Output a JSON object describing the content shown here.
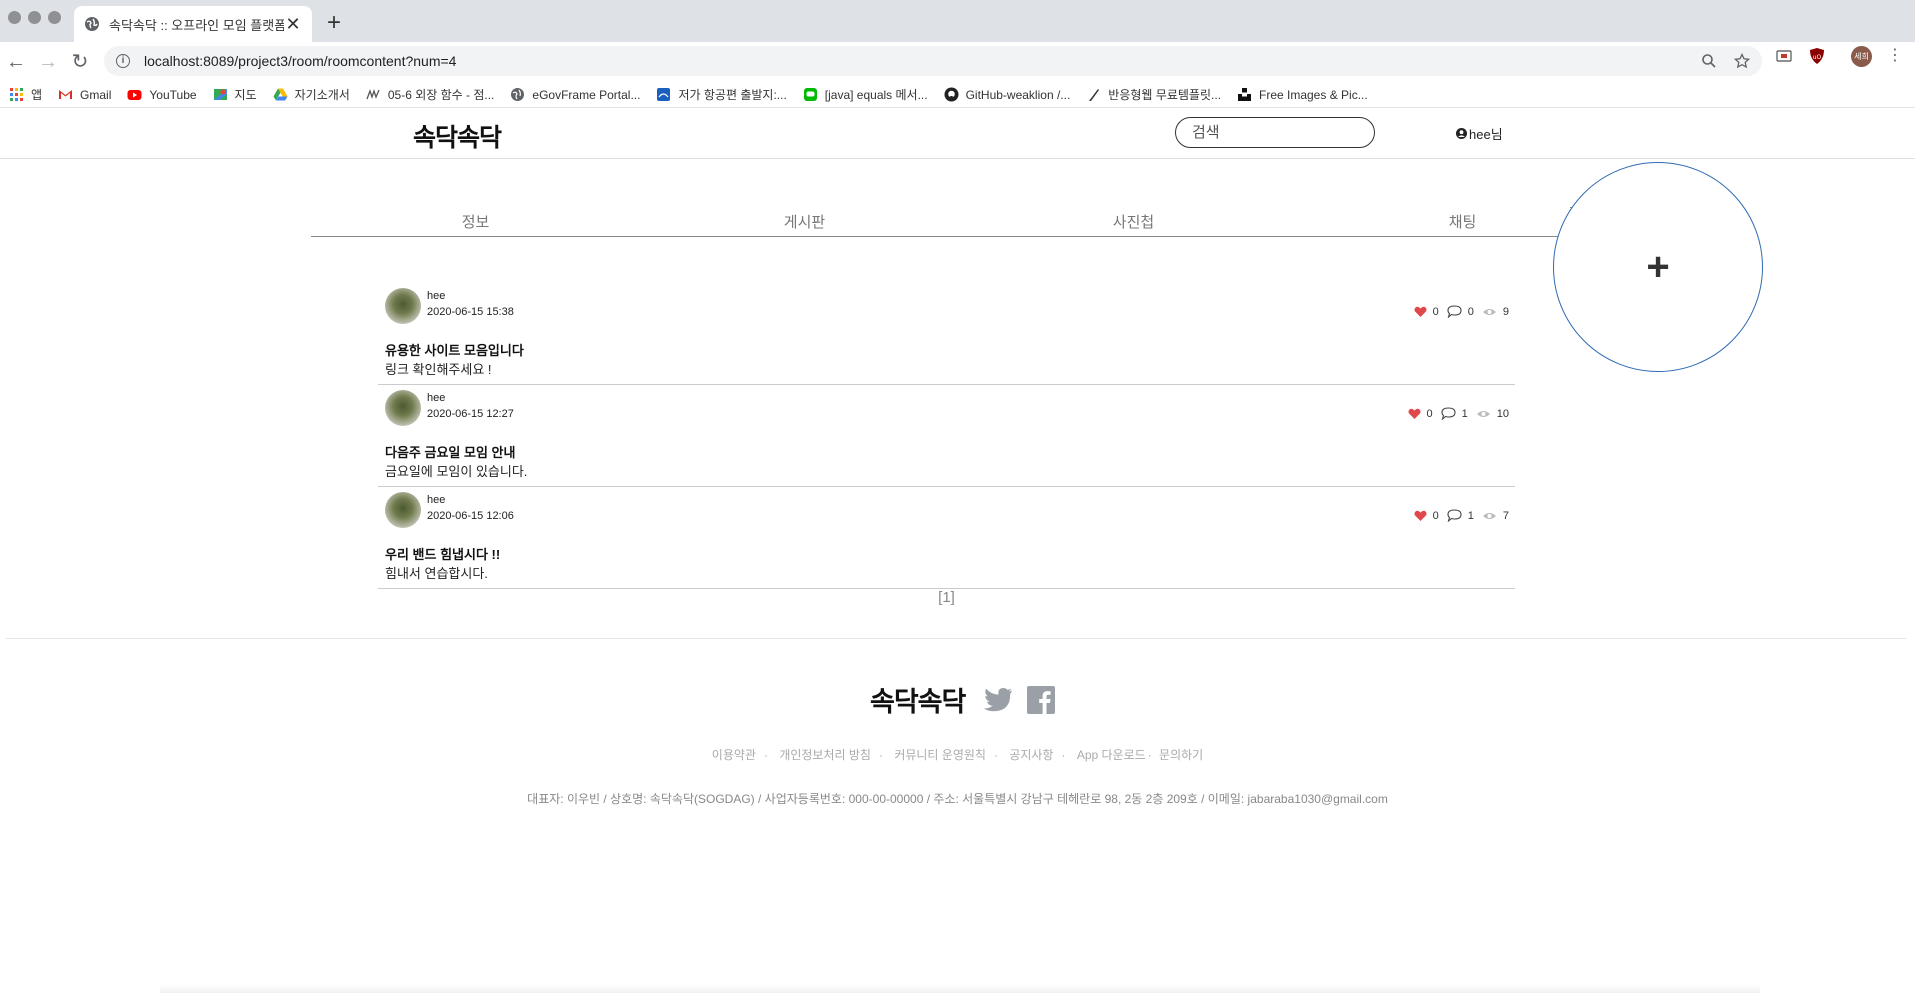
{
  "browser": {
    "tab_title": "속닥속닥 :: 오프라인 모임 플랫폼",
    "url": "localhost:8089/project3/room/roomcontent?num=4",
    "profile_label": "세희",
    "bookmarks": [
      {
        "label": "앱",
        "icon": "apps-grid-icon"
      },
      {
        "label": "Gmail",
        "icon": "gmail-icon"
      },
      {
        "label": "YouTube",
        "icon": "youtube-icon"
      },
      {
        "label": "지도",
        "icon": "maps-icon"
      },
      {
        "label": "자기소개서",
        "icon": "drive-icon"
      },
      {
        "label": "05-6 외장 함수 - 점...",
        "icon": "wikidocs-icon"
      },
      {
        "label": "eGovFrame Portal...",
        "icon": "globe-icon"
      },
      {
        "label": "저가 항공편 출발지:...",
        "icon": "flight-icon"
      },
      {
        "label": "[java] equals 메서...",
        "icon": "line-icon"
      },
      {
        "label": "GitHub-weaklion /...",
        "icon": "github-icon"
      },
      {
        "label": "반응형웹 무료템플릿...",
        "icon": "pen-icon"
      },
      {
        "label": "Free Images & Pic...",
        "icon": "unsplash-icon"
      }
    ]
  },
  "header": {
    "logo_text": "속닥속닥",
    "search_placeholder": "검색",
    "user_label": "hee님"
  },
  "room_tabs": [
    "정보",
    "게시판",
    "사진첩",
    "채팅"
  ],
  "posts": [
    {
      "author": "hee",
      "date": "2020-06-15 15:38",
      "likes": "0",
      "comments": "0",
      "views": "9",
      "title": "유용한 사이트 모음입니다",
      "body": "링크 확인해주세요 !"
    },
    {
      "author": "hee",
      "date": "2020-06-15 12:27",
      "likes": "0",
      "comments": "1",
      "views": "10",
      "title": "다음주 금요일 모임 안내",
      "body": "금요일에 모임이 있습니다."
    },
    {
      "author": "hee",
      "date": "2020-06-15 12:06",
      "likes": "0",
      "comments": "1",
      "views": "7",
      "title": "우리 밴드 힘냅시다 !!",
      "body": "힘내서 연습합시다."
    }
  ],
  "pagination": "[1]",
  "fab": {
    "label": "+"
  },
  "footer": {
    "logo_text": "속닥속닥",
    "links": [
      "이용약관",
      "개인정보처리 방침",
      "커뮤니티 운영원칙",
      "공지사항",
      "App 다운로드",
      "문의하기"
    ],
    "info": "대표자: 이우빈 / 상호명: 속닥속닥(SOGDAG) / 사업자등록번호: 000-00-00000 / 주소: 서울특별시 강남구 테헤란로 98, 2동 2층 209호 / 이메일: jabaraba1030@gmail.com"
  },
  "colors": {
    "heart": "#e0484b",
    "fab_border": "#2f6ab3",
    "twitter": "#9aa0a6",
    "facebook": "#9aa0a6"
  }
}
